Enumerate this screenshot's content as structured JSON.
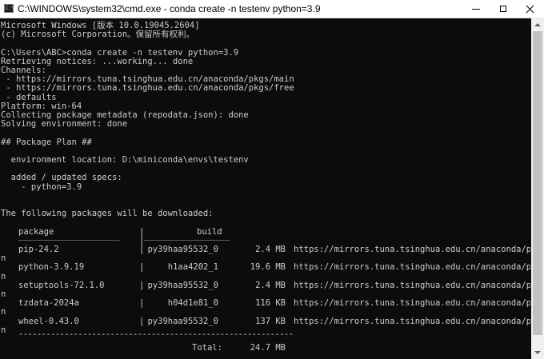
{
  "window": {
    "title": "C:\\WINDOWS\\system32\\cmd.exe - conda  create -n testenv python=3.9",
    "icon_text": "C:\\",
    "icon": "cmd-icon",
    "controls": [
      "minimize-icon",
      "maximize-icon",
      "close-icon"
    ]
  },
  "console": {
    "lines": [
      "Microsoft Windows [版本 10.0.19045.2604]",
      "(c) Microsoft Corporation。保留所有权利。",
      "",
      "C:\\Users\\ABC>conda create -n testenv python=3.9",
      "Retrieving notices: ...working... done",
      "Channels:",
      " - https://mirrors.tuna.tsinghua.edu.cn/anaconda/pkgs/main",
      " - https://mirrors.tuna.tsinghua.edu.cn/anaconda/pkgs/free",
      " - defaults",
      "Platform: win-64",
      "Collecting package metadata (repodata.json): done",
      "Solving environment: done",
      "",
      "## Package Plan ##",
      "",
      "  environment location: D:\\miniconda\\envs\\testenv",
      "",
      "  added / updated specs:",
      "    - python=3.9",
      "",
      "",
      "The following packages will be downloaded:"
    ],
    "table": {
      "headers": {
        "package": "package",
        "build": "build"
      },
      "separator_package": "____________________",
      "separator_build": "_________________",
      "divider": "|",
      "rows": [
        {
          "package": "pip-24.2",
          "build": "py39haa95532_0",
          "size": "2.4 MB",
          "url": "https://mirrors.tuna.tsinghua.edu.cn/anaconda/pkgs/mai",
          "wrap": "n"
        },
        {
          "package": "python-3.9.19",
          "build": "h1aa4202_1",
          "size": "19.6 MB",
          "url": "https://mirrors.tuna.tsinghua.edu.cn/anaconda/pkgs/mai",
          "wrap": "n"
        },
        {
          "package": "setuptools-72.1.0",
          "build": "py39haa95532_0",
          "size": "2.4 MB",
          "url": "https://mirrors.tuna.tsinghua.edu.cn/anaconda/pkgs/mai",
          "wrap": "n"
        },
        {
          "package": "tzdata-2024a",
          "build": "h04d1e81_0",
          "size": "116 KB",
          "url": "https://mirrors.tuna.tsinghua.edu.cn/anaconda/pkgs/mai",
          "wrap": "n"
        },
        {
          "package": "wheel-0.43.0",
          "build": "py39haa95532_0",
          "size": "137 KB",
          "url": "https://mirrors.tuna.tsinghua.edu.cn/anaconda/pkgs/mai",
          "wrap": "n"
        }
      ],
      "total_separator": "------------------------------------------------------------",
      "total_label": "Total:",
      "total_value": "24.7 MB"
    }
  },
  "scrollbar": {
    "up_icon": "scroll-up-arrow-icon",
    "down_icon": "scroll-down-arrow-icon"
  },
  "colors": {
    "background": "#0c0c0c",
    "text": "#cccccc",
    "titlebar": "#ffffff"
  }
}
